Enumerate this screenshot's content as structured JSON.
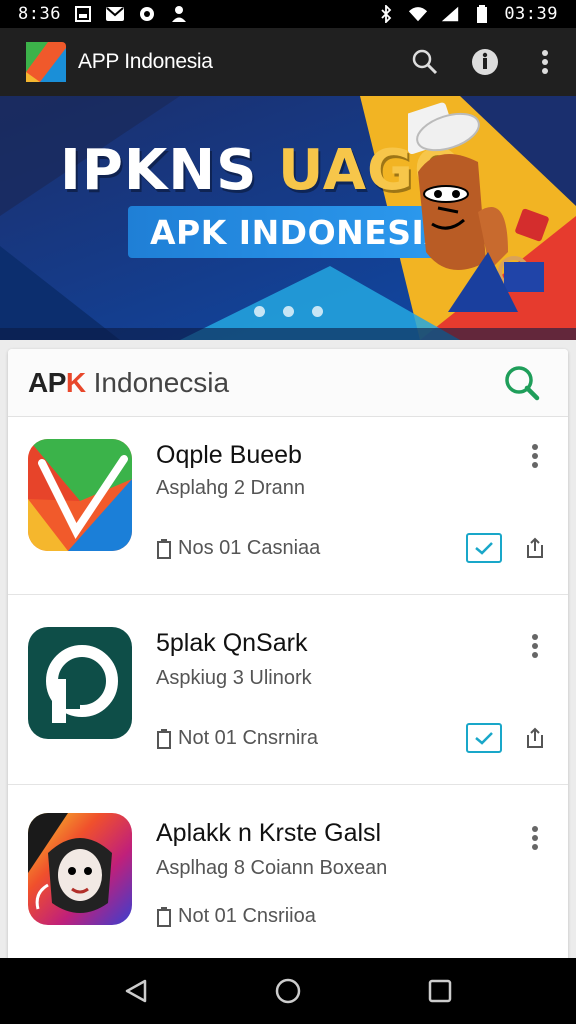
{
  "status_bar": {
    "time_left": "8:36",
    "time_right": "03:39",
    "icons": [
      "gallery-icon",
      "mail-icon",
      "settings-icon",
      "person-icon",
      "bluetooth-icon",
      "wifi-icon",
      "signal-icon",
      "battery-icon"
    ]
  },
  "app_bar": {
    "title": "APP Indonesia",
    "actions": [
      "search-icon",
      "info-icon",
      "more-vert-icon"
    ]
  },
  "banner": {
    "headline_white": "IPKNS ",
    "headline_gold": "UAGO",
    "subtitle": "APK INDONESIA",
    "dots": 3
  },
  "card": {
    "brand_a": "AP",
    "brand_k": "K",
    "brand_name": "Indonecsia"
  },
  "apps": [
    {
      "name": "Oqple Bueeb",
      "developer": "Asplahg  2  Drann",
      "meta": "Nos 01  Casniaa"
    },
    {
      "name": "5plak QnSark",
      "developer": "Aspkiug  3  Ulinork",
      "meta": "Not 01  Cnsrnira"
    },
    {
      "name": "Aplakk n Krste Galsl",
      "developer": "Asplhag  8  Coiann  Boxean",
      "meta": "Not 01  Cnsriioa"
    }
  ],
  "colors": {
    "accent_teal": "#19a7c9",
    "search_green": "#1f9e5a",
    "brand_orange": "#e8472b"
  }
}
